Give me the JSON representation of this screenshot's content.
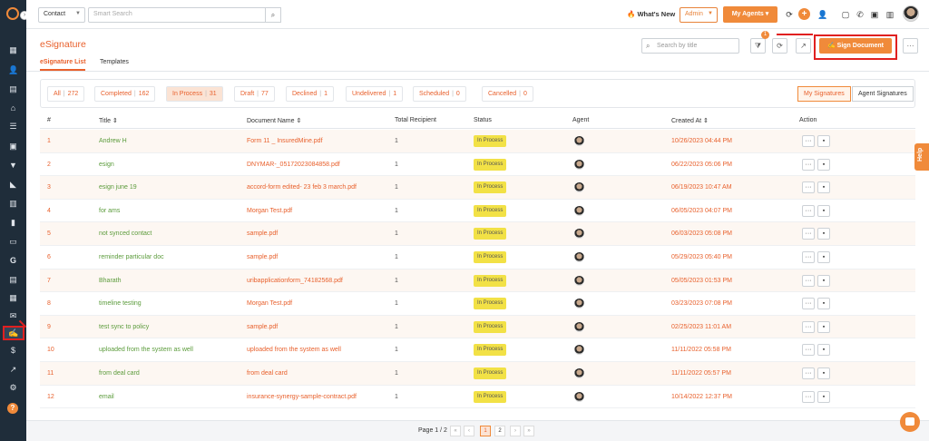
{
  "top": {
    "contact_select": "Contact",
    "search_placeholder": "Smart Search",
    "whats_new": "What's New",
    "admin_select": "Admin",
    "my_agents": "My Agents"
  },
  "header": {
    "title": "eSignature",
    "tabs": [
      "eSignature List",
      "Templates"
    ],
    "search_placeholder": "Search by title",
    "filter_badge": "1",
    "sign_button": "Sign Document"
  },
  "filters": [
    {
      "label": "All",
      "count": "272"
    },
    {
      "label": "Completed",
      "count": "162"
    },
    {
      "label": "In Process",
      "count": "31"
    },
    {
      "label": "Draft",
      "count": "77"
    },
    {
      "label": "Declined",
      "count": "1"
    },
    {
      "label": "Undelivered",
      "count": "1"
    },
    {
      "label": "Scheduled",
      "count": "0"
    },
    {
      "label": "Cancelled",
      "count": "0"
    }
  ],
  "signature_toggle": [
    "My Signatures",
    "Agent Signatures"
  ],
  "table": {
    "columns": [
      "#",
      "Title",
      "Document Name",
      "Total Recipient",
      "Status",
      "Agent",
      "Created At",
      "Action"
    ],
    "rows": [
      {
        "num": "1",
        "title": "Andrew H",
        "doc": "Form 11 _ InsuredMine.pdf",
        "recipients": "1",
        "status": "In Process",
        "created": "10/26/2023 04:44 PM"
      },
      {
        "num": "2",
        "title": "esign",
        "doc": "DNYMAR-_05172023084858.pdf",
        "recipients": "1",
        "status": "In Process",
        "created": "06/22/2023 05:06 PM"
      },
      {
        "num": "3",
        "title": "esign june 19",
        "doc": "accord-form edited- 23 feb 3 march.pdf",
        "recipients": "1",
        "status": "In Process",
        "created": "06/19/2023 10:47 AM"
      },
      {
        "num": "4",
        "title": "for ams",
        "doc": "Morgan Test.pdf",
        "recipients": "1",
        "status": "In Process",
        "created": "06/05/2023 04:07 PM"
      },
      {
        "num": "5",
        "title": "not synced contact",
        "doc": "sample.pdf",
        "recipients": "1",
        "status": "In Process",
        "created": "06/03/2023 05:08 PM"
      },
      {
        "num": "6",
        "title": "reminder particular doc",
        "doc": "sample.pdf",
        "recipients": "1",
        "status": "In Process",
        "created": "05/29/2023 05:40 PM"
      },
      {
        "num": "7",
        "title": "Bharath",
        "doc": "uribapplicationform_74182568.pdf",
        "recipients": "1",
        "status": "In Process",
        "created": "05/05/2023 01:53 PM"
      },
      {
        "num": "8",
        "title": "timeline testing",
        "doc": "Morgan Test.pdf",
        "recipients": "1",
        "status": "In Process",
        "created": "03/23/2023 07:08 PM"
      },
      {
        "num": "9",
        "title": "test sync to policy",
        "doc": "sample.pdf",
        "recipients": "1",
        "status": "In Process",
        "created": "02/25/2023 11:01 AM"
      },
      {
        "num": "10",
        "title": "uploaded from the system as well",
        "doc": "uploaded from the system as well",
        "recipients": "1",
        "status": "In Process",
        "created": "11/11/2022 05:58 PM"
      },
      {
        "num": "11",
        "title": "from deal card",
        "doc": "from deal card",
        "recipients": "1",
        "status": "In Process",
        "created": "11/11/2022 05:57 PM"
      },
      {
        "num": "12",
        "title": "email",
        "doc": "insurance-synergy-sample-contract.pdf",
        "recipients": "1",
        "status": "In Process",
        "created": "10/14/2022 12:37 PM"
      }
    ]
  },
  "pagination": {
    "info": "Page 1 / 2",
    "pages": [
      "1",
      "2"
    ]
  },
  "help_tab": "Help",
  "colors": {
    "accent": "#f08a3a",
    "title": "#e8602c",
    "link_green": "#5b9b3b",
    "status_badge": "#f2e146",
    "nav_bg": "#1f2d3a",
    "highlight_red": "#e02020"
  }
}
